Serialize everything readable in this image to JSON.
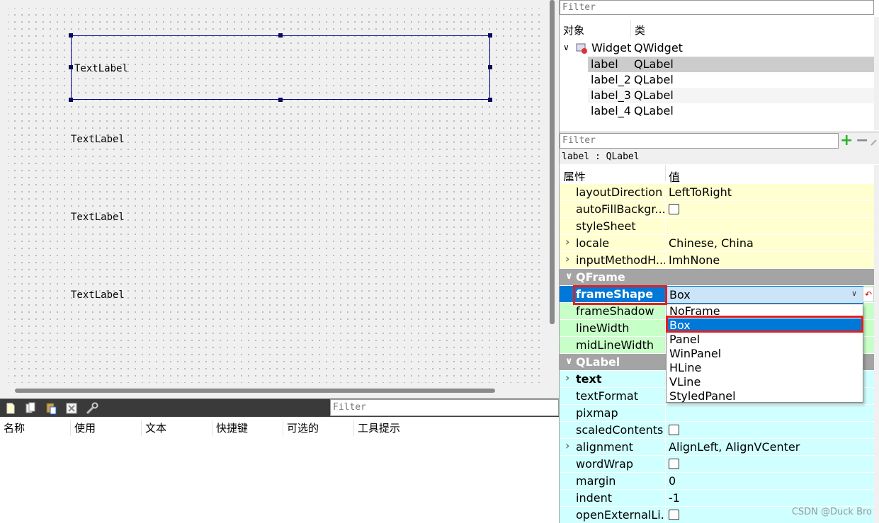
{
  "canvas": {
    "labels": [
      "TextLabel",
      "TextLabel",
      "TextLabel",
      "TextLabel"
    ]
  },
  "action_editor": {
    "filter_placeholder": "Filter",
    "columns": [
      "名称",
      "使用",
      "文本",
      "快捷键",
      "可选的",
      "工具提示"
    ],
    "toolbar_icons": [
      "new-action-icon",
      "copy-icon",
      "paste-icon",
      "delete-icon",
      "configure-icon"
    ]
  },
  "object_inspector": {
    "filter_placeholder": "Filter",
    "headers": {
      "object": "对象",
      "class": "类"
    },
    "root": {
      "name": "Widget",
      "class": "QWidget"
    },
    "children": [
      {
        "name": "label",
        "class": "QLabel",
        "selected": true
      },
      {
        "name": "label_2",
        "class": "QLabel",
        "selected": false
      },
      {
        "name": "label_3",
        "class": "QLabel",
        "selected": false
      },
      {
        "name": "label_4",
        "class": "QLabel",
        "selected": false
      }
    ]
  },
  "property_editor": {
    "filter_placeholder": "Filter",
    "context": "label : QLabel",
    "headers": {
      "property": "属性",
      "value": "值"
    },
    "rows": [
      {
        "name": "layoutDirection",
        "value": "LeftToRight",
        "color": "yellow"
      },
      {
        "name": "autoFillBackgr...",
        "value": "",
        "checkbox": true,
        "color": "yellow"
      },
      {
        "name": "styleSheet",
        "value": "",
        "color": "yellow"
      },
      {
        "name": "locale",
        "value": "Chinese, China",
        "expandable": true,
        "color": "yellow"
      },
      {
        "name": "inputMethodH...",
        "value": "ImhNone",
        "expandable": true,
        "color": "yellow"
      },
      {
        "name": "QFrame",
        "group": true
      },
      {
        "name": "frameShape",
        "value": "Box",
        "bold": true,
        "color": "green",
        "editing": true
      },
      {
        "name": "frameShadow",
        "value": "",
        "color": "green"
      },
      {
        "name": "lineWidth",
        "value": "",
        "color": "green"
      },
      {
        "name": "midLineWidth",
        "value": "",
        "color": "green"
      },
      {
        "name": "QLabel",
        "group": true
      },
      {
        "name": "text",
        "value": "",
        "bold": true,
        "expandable": true,
        "color": "cyan"
      },
      {
        "name": "textFormat",
        "value": "",
        "color": "cyan"
      },
      {
        "name": "pixmap",
        "value": "",
        "color": "cyan"
      },
      {
        "name": "scaledContents",
        "value": "",
        "checkbox": true,
        "color": "cyan"
      },
      {
        "name": "alignment",
        "value": "AlignLeft, AlignVCenter",
        "expandable": true,
        "color": "cyan"
      },
      {
        "name": "wordWrap",
        "value": "",
        "checkbox": true,
        "color": "cyan"
      },
      {
        "name": "margin",
        "value": "0",
        "color": "cyan"
      },
      {
        "name": "indent",
        "value": "-1",
        "color": "cyan"
      },
      {
        "name": "openExternalLi...",
        "value": "",
        "checkbox": true,
        "color": "cyan"
      }
    ],
    "dropdown": {
      "current": "Box",
      "options": [
        "NoFrame",
        "Box",
        "Panel",
        "WinPanel",
        "HLine",
        "VLine",
        "StyledPanel"
      ],
      "selected_index": 1
    },
    "toolbar": {
      "add": "+",
      "remove": "−"
    }
  },
  "watermark": "CSDN @Duck Bro",
  "colors": {
    "selection": "#0078d7",
    "highlight_frame": "#e02020",
    "group_header": "#a4a4a4"
  }
}
